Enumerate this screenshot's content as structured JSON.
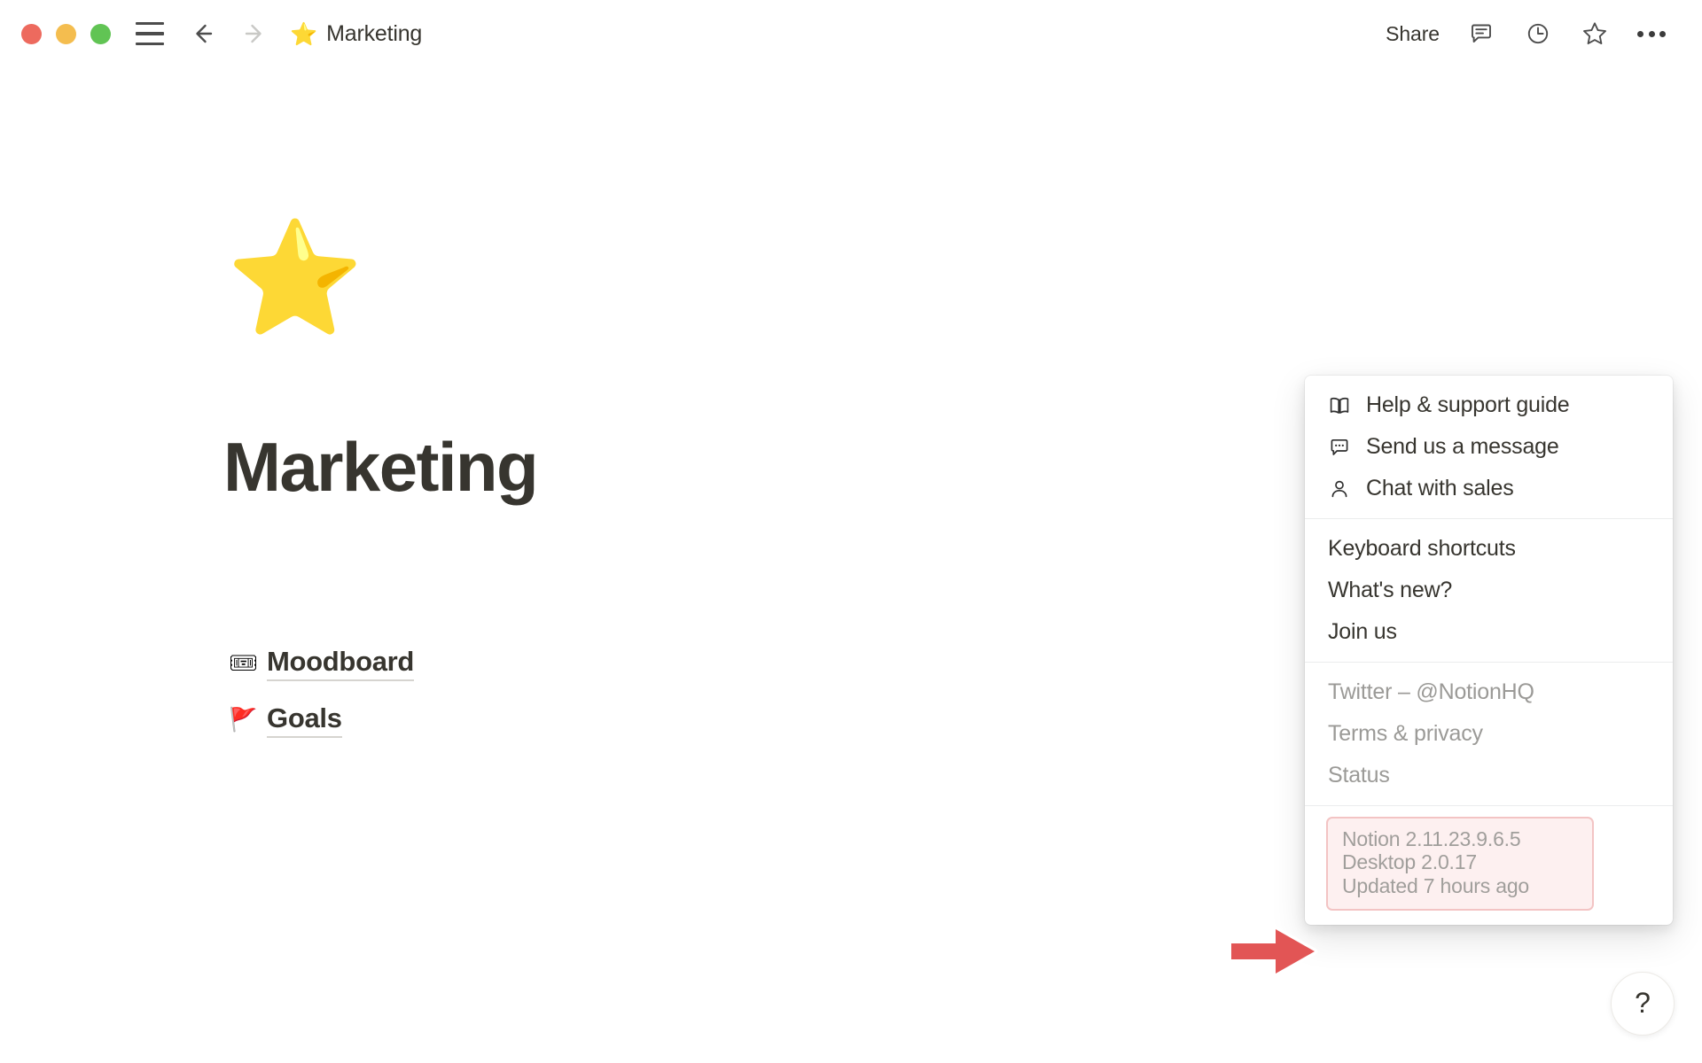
{
  "window": {
    "traffic_lights": {
      "close_color": "#ED6A5E",
      "minimize_color": "#F4BD4F",
      "maximize_color": "#61C454"
    }
  },
  "titlebar": {
    "breadcrumb_emoji": "⭐",
    "breadcrumb_title": "Marketing",
    "share_label": "Share",
    "icons": [
      "comment-icon",
      "history-clock-icon",
      "favorite-star-icon",
      "more-options-icon"
    ]
  },
  "page": {
    "icon_emoji": "⭐",
    "title": "Marketing",
    "links": [
      {
        "emoji": "🎟",
        "label": "Moodboard"
      },
      {
        "emoji": "🚩",
        "label": "Goals"
      }
    ]
  },
  "help_menu": {
    "group_support": [
      {
        "icon": "book-icon",
        "label": "Help & support guide"
      },
      {
        "icon": "chat-bubble-icon",
        "label": "Send us a message"
      },
      {
        "icon": "person-icon",
        "label": "Chat with sales"
      }
    ],
    "group_actions": [
      {
        "label": "Keyboard shortcuts"
      },
      {
        "label": "What's new?"
      },
      {
        "label": "Join us"
      }
    ],
    "group_links": [
      {
        "label": "Twitter – @NotionHQ"
      },
      {
        "label": "Terms & privacy"
      },
      {
        "label": "Status"
      }
    ],
    "version": {
      "app_version": "Notion 2.11.23.9.6.5",
      "desktop_version": "Desktop 2.0.17",
      "updated": "Updated 7 hours ago",
      "highlight_border_color": "#f3c4c4",
      "highlight_fill_color": "#fdf0f0"
    }
  },
  "annotation": {
    "arrow_color": "#E25555",
    "arrow_name": "right-pointing-arrow"
  },
  "help_bubble": {
    "label": "?"
  }
}
